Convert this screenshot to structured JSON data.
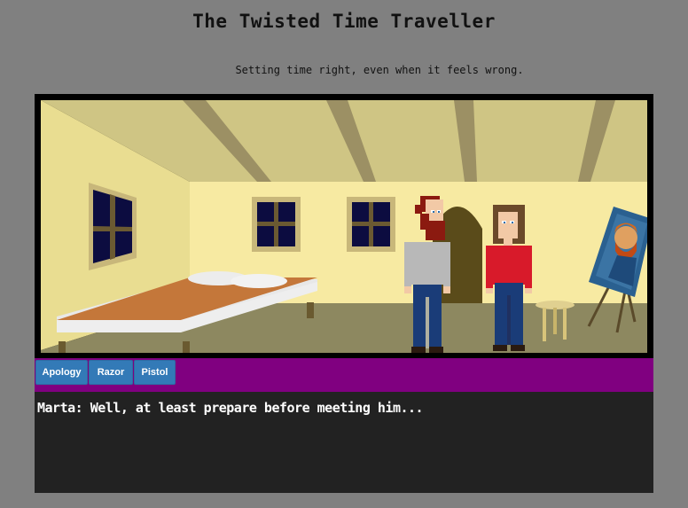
{
  "header": {
    "title": "The Twisted Time Traveller",
    "subtitle": "Setting time right, even when it feels wrong."
  },
  "inventory": {
    "items": [
      {
        "label": "Apology"
      },
      {
        "label": "Razor"
      },
      {
        "label": "Pistol"
      }
    ]
  },
  "dialog": {
    "text": "Marta: Well, at least prepare before meeting him..."
  },
  "colors": {
    "page_bg": "#808080",
    "inventory_bg": "#800080",
    "button_bg": "#337ab7",
    "dialog_bg": "#222222"
  }
}
